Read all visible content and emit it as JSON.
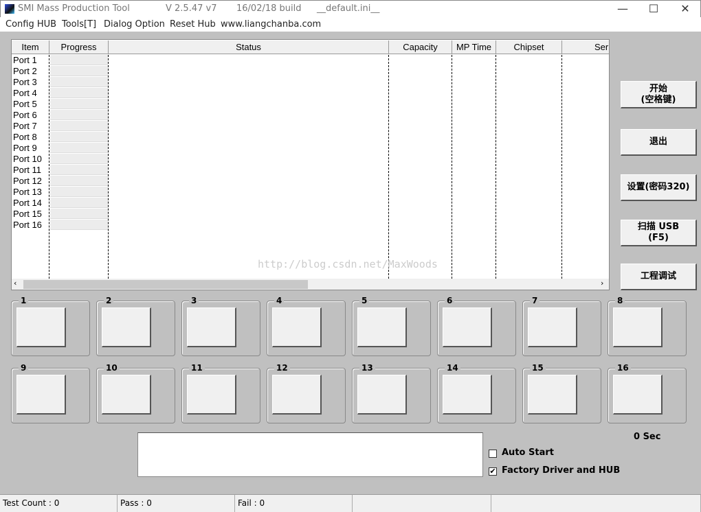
{
  "title": {
    "app": "SMI Mass Production Tool",
    "version": "V 2.5.47   v7",
    "build": "16/02/18 build",
    "ini": "__default.ini__"
  },
  "window_controls": {
    "minimize": "—",
    "maximize": "☐",
    "close": "✕"
  },
  "menu": [
    "Config HUB",
    "Tools[T]",
    "Dialog Option",
    "Reset Hub",
    "www.liangchanba.com"
  ],
  "list": {
    "columns": [
      "Item",
      "Progress",
      "Status",
      "Capacity",
      "MP Time",
      "Chipset",
      "Ser"
    ],
    "ports": [
      "Port 1",
      "Port 2",
      "Port 3",
      "Port 4",
      "Port 5",
      "Port 6",
      "Port 7",
      "Port 8",
      "Port 9",
      "Port 10",
      "Port 11",
      "Port 12",
      "Port 13",
      "Port 14",
      "Port 15",
      "Port 16"
    ]
  },
  "watermark": "http://blog.csdn.net/MaxWoods",
  "buttons": {
    "start": "开始\n(空格键)",
    "exit": "退出",
    "settings": "设置(密码320)",
    "scan": "扫描 USB\n(F5)",
    "debug": "工程调试"
  },
  "port_groups": [
    "1",
    "2",
    "3",
    "4",
    "5",
    "6",
    "7",
    "8",
    "9",
    "10",
    "11",
    "12",
    "13",
    "14",
    "15",
    "16"
  ],
  "timer": "0 Sec",
  "options": {
    "auto_start": {
      "label": "Auto Start",
      "checked": false
    },
    "factory_driver": {
      "label": "Factory Driver and HUB",
      "checked": true
    }
  },
  "statusbar": {
    "test_count": "Test Count : 0",
    "pass": "Pass : 0",
    "fail": "Fail : 0"
  }
}
